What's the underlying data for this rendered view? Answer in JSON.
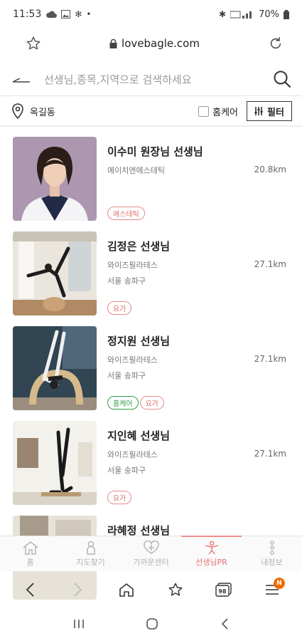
{
  "status_bar": {
    "time": "11:53",
    "battery": "70%"
  },
  "browser": {
    "url": "lovebagle.com"
  },
  "search": {
    "placeholder": "선생님,종목,지역으로 검색하세요"
  },
  "location": {
    "label": "옥길동"
  },
  "filters": {
    "homecare_label": "홈케어",
    "filter_label": "필터"
  },
  "teachers": [
    {
      "name": "이수미 원장님 선생님",
      "line1": "에이치엔에스테틱",
      "line2": "",
      "distance": "20.8km",
      "tags": [
        {
          "label": "에스테틱",
          "style": "red"
        }
      ]
    },
    {
      "name": "김정은 선생님",
      "line1": "와이즈필라테스",
      "line2": "서울 송파구",
      "distance": "27.1km",
      "tags": [
        {
          "label": "요가",
          "style": "red"
        }
      ]
    },
    {
      "name": "정지원 선생님",
      "line1": "와이즈필라테스",
      "line2": "서울 송파구",
      "distance": "27.1km",
      "tags": [
        {
          "label": "홈케어",
          "style": "green"
        },
        {
          "label": "요가",
          "style": "red"
        }
      ]
    },
    {
      "name": "지인혜 선생님",
      "line1": "와이즈필라테스",
      "line2": "서울 송파구",
      "distance": "27.1km",
      "tags": [
        {
          "label": "요가",
          "style": "red"
        }
      ]
    },
    {
      "name": "라혜정 선생님",
      "line1": "",
      "line2": "",
      "distance": "",
      "tags": []
    }
  ],
  "tabs": [
    {
      "label": "홈",
      "icon": "home-icon",
      "active": false
    },
    {
      "label": "지도찾기",
      "icon": "map-person-icon",
      "active": false
    },
    {
      "label": "가까운센터",
      "icon": "heart-center-icon",
      "active": false
    },
    {
      "label": "선생님PR",
      "icon": "teacher-pr-icon",
      "active": true
    },
    {
      "label": "내정보",
      "icon": "my-info-icon",
      "active": false
    }
  ],
  "browser_nav": {
    "tabs_count": "98",
    "notification_badge": "N"
  },
  "colors": {
    "accent": "#e57373",
    "tag_red": "#e06c6c",
    "tag_green": "#2f9e44",
    "badge_orange": "#ef6c00"
  }
}
